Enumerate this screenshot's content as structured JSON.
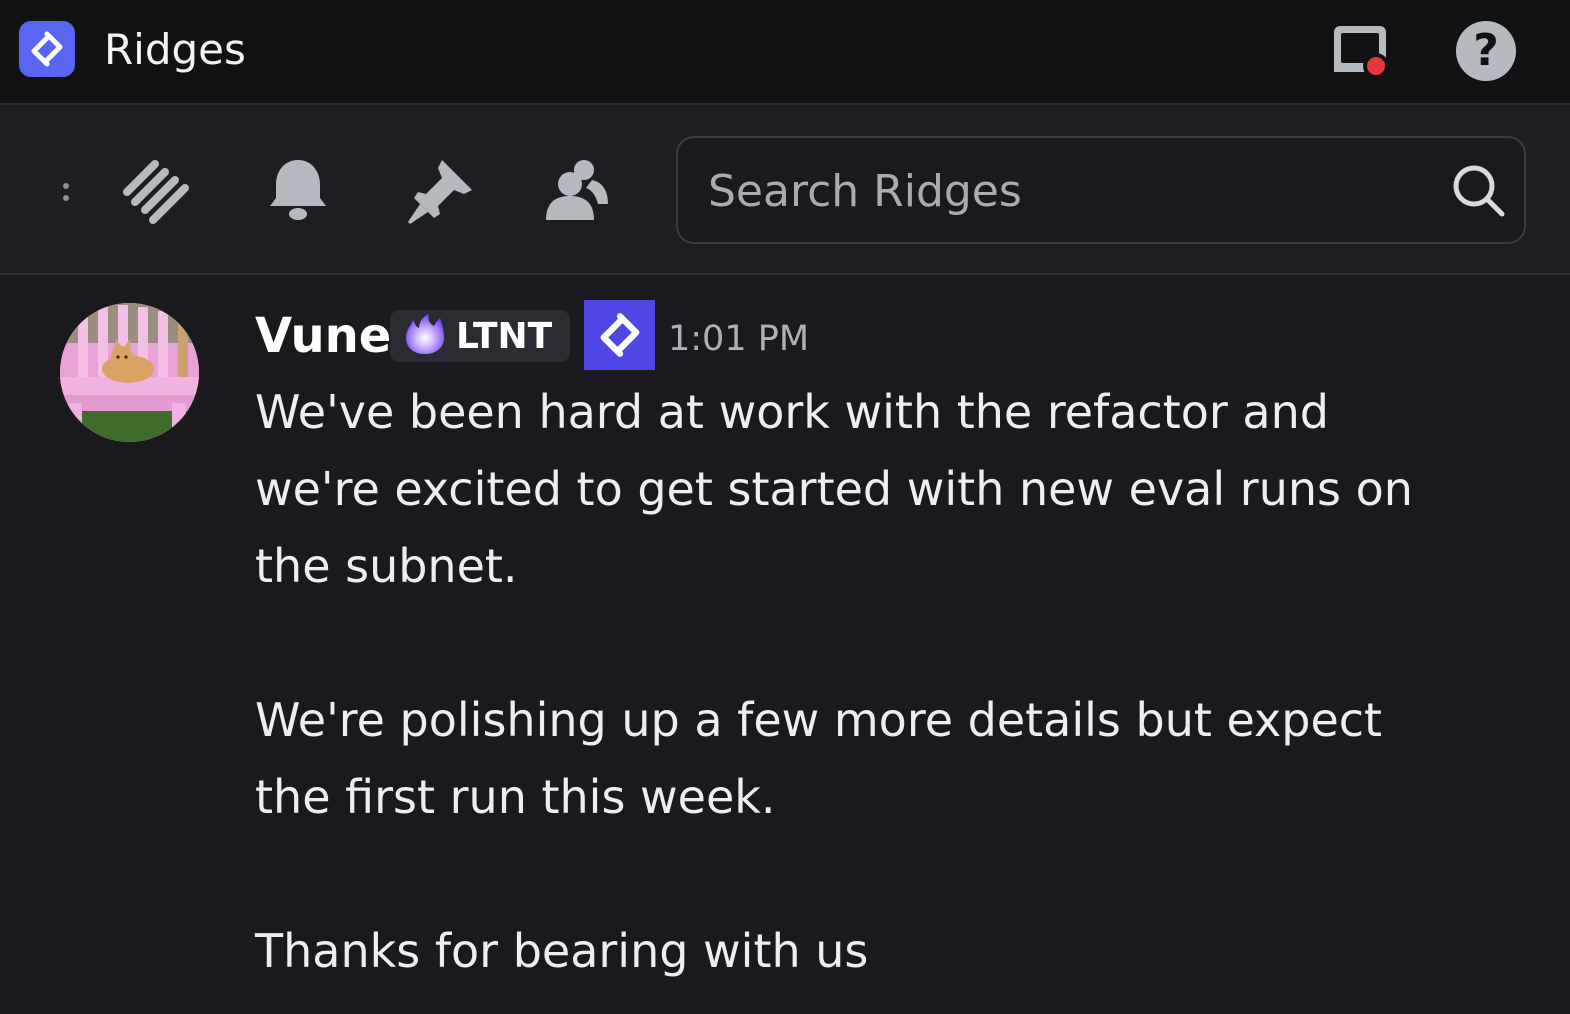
{
  "app": {
    "title": "Ridges",
    "logo_icon": "ridges-logo-icon",
    "accent_color": "#5865f2"
  },
  "titlebar": {
    "inbox_icon": "inbox-icon",
    "inbox_has_unread": true,
    "help_label": "?"
  },
  "toolbar": {
    "icons": [
      "threads-icon",
      "bell-icon",
      "pin-icon",
      "members-icon"
    ],
    "search": {
      "placeholder": "Search Ridges"
    }
  },
  "message": {
    "author": "Vune",
    "role_tag": "LTNT",
    "role_icon": "flame-icon",
    "server_badge_icon": "ridges-logo-icon",
    "timestamp": "1:01 PM",
    "paragraphs": [
      "We've been hard at work with the refactor and we're excited to get started with new eval runs on the subnet.",
      "We're polishing up a few more details but expect the first run this week.",
      "Thanks for bearing with us"
    ]
  }
}
